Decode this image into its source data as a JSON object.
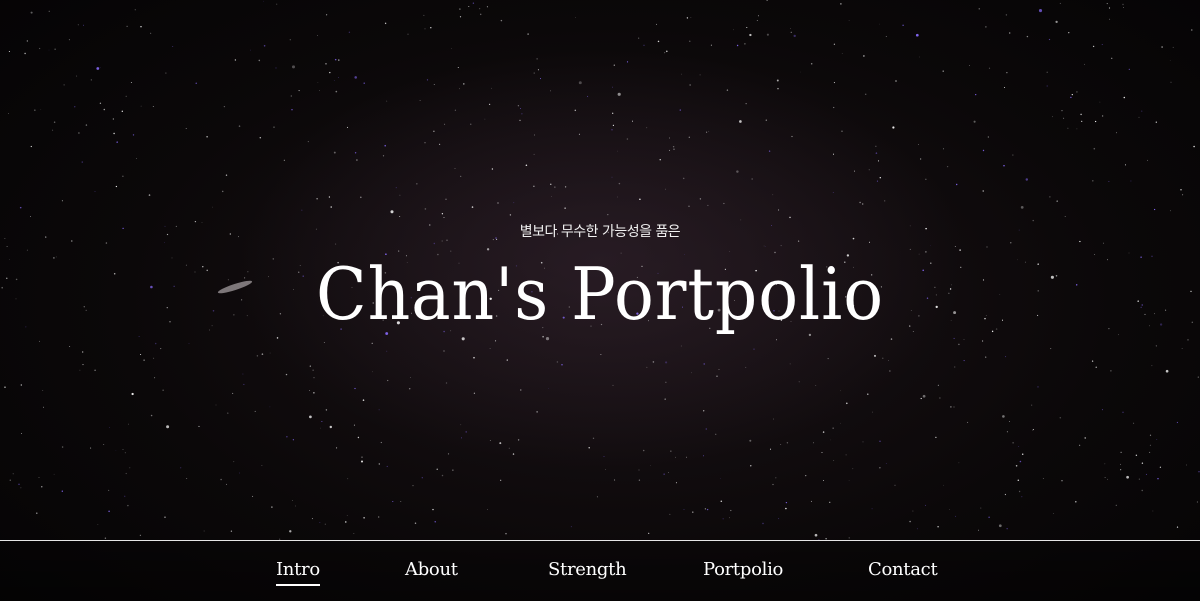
{
  "hero": {
    "subtitle": "별보다 무수한 가능성을 품은",
    "title": "Chan's Portpolio"
  },
  "nav": {
    "items": [
      {
        "label": "Intro",
        "active": true
      },
      {
        "label": "About",
        "active": false
      },
      {
        "label": "Strength",
        "active": false
      },
      {
        "label": "Portpolio",
        "active": false
      },
      {
        "label": "Contact",
        "active": false
      }
    ]
  },
  "colors": {
    "text": "#ffffff",
    "background": "#0b0809",
    "star_accent": "#8a6cff"
  }
}
